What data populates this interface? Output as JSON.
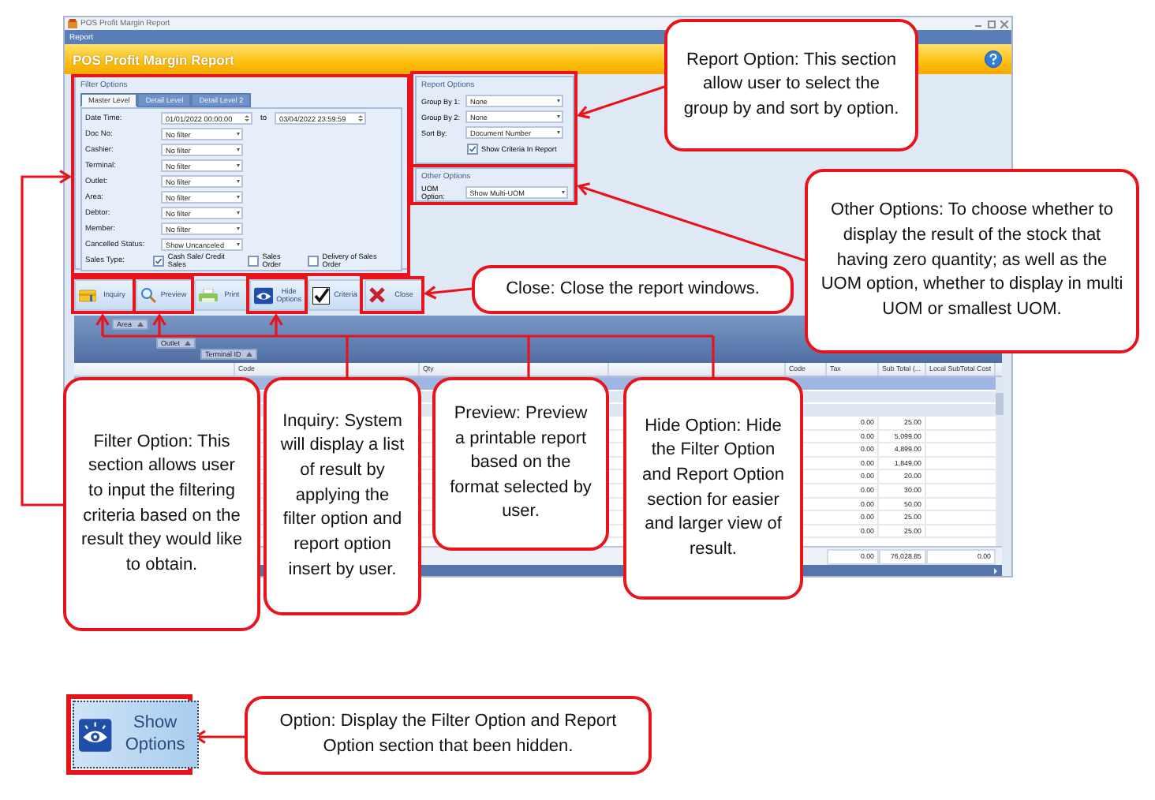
{
  "window": {
    "title": "POS Profit Margin Report"
  },
  "menu": [
    "Report"
  ],
  "header": {
    "title": "POS Profit Margin Report"
  },
  "filter_options": {
    "title": "Filter Options",
    "tabs": [
      {
        "label": "Master Level",
        "selected": true
      },
      {
        "label": "Detail Level",
        "selected": false
      },
      {
        "label": "Detail Level 2",
        "selected": false
      }
    ],
    "date_time": {
      "label": "Date Time:",
      "from": "01/01/2022 00:00:00",
      "to_label": "to",
      "to": "03/04/2022 23:59:59"
    },
    "fields": [
      {
        "label": "Doc No:",
        "value": "No filter"
      },
      {
        "label": "Cashier:",
        "value": "No filter"
      },
      {
        "label": "Terminal:",
        "value": "No filter"
      },
      {
        "label": "Outlet:",
        "value": "No filter"
      },
      {
        "label": "Area:",
        "value": "No filter"
      },
      {
        "label": "Debtor:",
        "value": "No filter"
      },
      {
        "label": "Member:",
        "value": "No filter"
      },
      {
        "label": "Cancelled Status:",
        "value": "Show Uncanceled"
      }
    ],
    "sales_type": {
      "label": "Sales Type:",
      "options": [
        {
          "label": "Cash Sale/ Credit Sales",
          "checked": true
        },
        {
          "label": "Sales Order",
          "checked": false
        },
        {
          "label": "Delivery of Sales Order",
          "checked": false
        }
      ]
    }
  },
  "report_options": {
    "title": "Report Options",
    "fields": [
      {
        "label": "Group By 1:",
        "value": "None"
      },
      {
        "label": "Group By 2:",
        "value": "None"
      },
      {
        "label": "Sort By:",
        "value": "Document Number"
      }
    ],
    "show_criteria": {
      "label": "Show Criteria In Report",
      "checked": true
    }
  },
  "other_options": {
    "title": "Other Options",
    "fields": [
      {
        "label": "UOM Option:",
        "value": "Show Multi-UOM"
      }
    ]
  },
  "toolbar": [
    {
      "label": "Inquiry",
      "kind": "inquiry"
    },
    {
      "label": "Preview",
      "kind": "preview"
    },
    {
      "label": "Print",
      "kind": "print"
    },
    {
      "label": "Hide Options",
      "kind": "options"
    },
    {
      "label": "Criteria",
      "kind": "criteria"
    },
    {
      "label": "Close",
      "kind": "close"
    }
  ],
  "grid": {
    "group_chips": [
      "Area",
      "Outlet",
      "Terminal ID"
    ],
    "columns": [
      {
        "header": "Code"
      },
      {
        "header": "Qty"
      },
      {
        "header": "Code"
      },
      {
        "header": "Tax"
      },
      {
        "header": "Sub Total (..."
      },
      {
        "header": "Local SubTotal Cost"
      }
    ],
    "rows": [
      {
        "tax": "0.00",
        "sub_total": "25.00"
      },
      {
        "tax": "0.00",
        "sub_total": "5,099.00"
      },
      {
        "tax": "0.00",
        "sub_total": "4,899.00"
      },
      {
        "tax": "0.00",
        "sub_total": "1,849.00"
      },
      {
        "tax": "0.00",
        "sub_total": "20.00"
      },
      {
        "tax": "0.00",
        "sub_total": "30.00"
      },
      {
        "tax": "0.00",
        "sub_total": "50.00"
      },
      {
        "tax": "0.00",
        "sub_total": "25.00"
      },
      {
        "tax": "0.00",
        "sub_total": "25.00"
      }
    ],
    "footer": {
      "tax": "0.00",
      "sub_total": "76,028.85",
      "local_subtotal_cost": "0.00"
    }
  },
  "callouts": [
    "Report Option: This section allow user to select the group by and sort by option.",
    "Other Options: To choose whether to display the result of the stock that having zero quantity; as well as the UOM option, whether to display in multi UOM or smallest UOM.",
    "Close: Close the report windows.",
    "Filter Option: This section allows user to input the filtering criteria based on the result they would like to obtain.",
    "Inquiry: System will display a list of result by applying the filter option and report option insert by user.",
    "Preview: Preview a printable report based on the format selected by user.",
    "Hide Option: Hide the Filter Option and Report Option section for easier and larger view of result.",
    "Option: Display the Filter Option and Report Option section that been hidden."
  ],
  "show_options_button": {
    "label": "Show Options"
  }
}
